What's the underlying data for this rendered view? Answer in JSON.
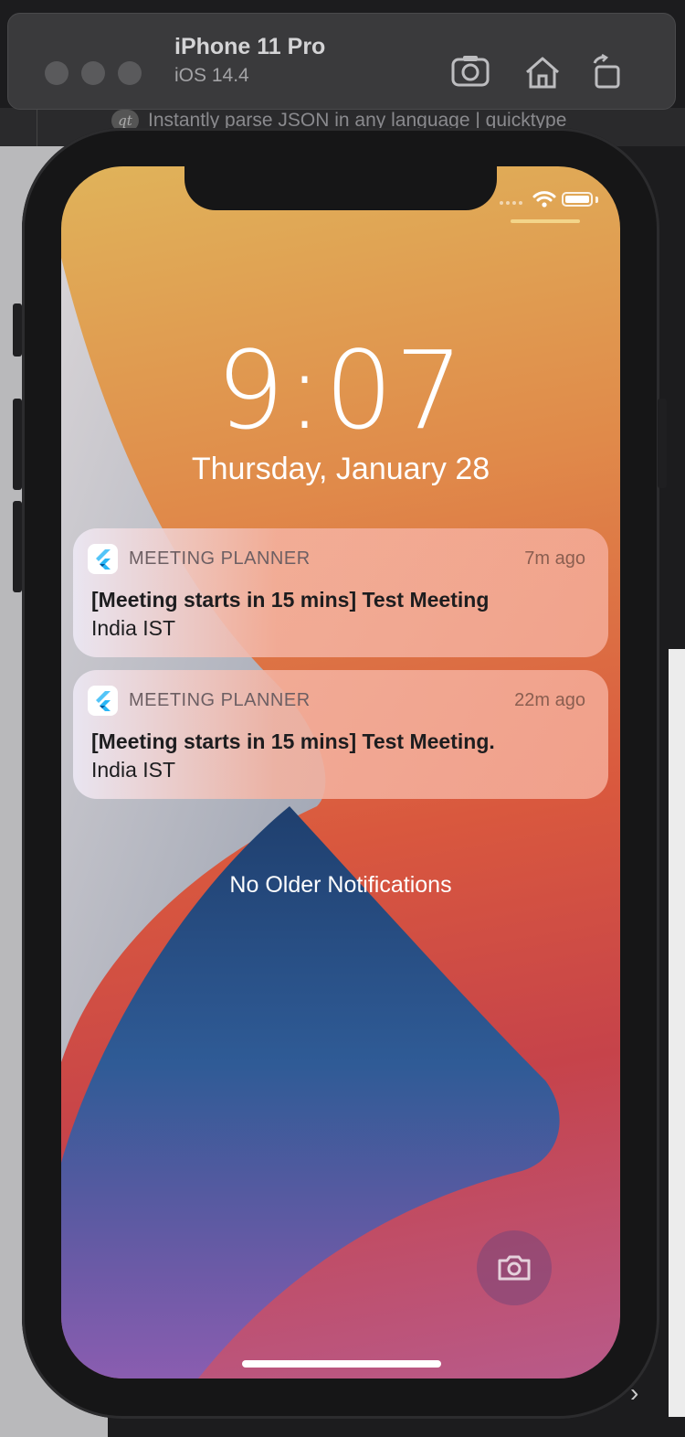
{
  "simulator": {
    "device_name": "iPhone 11 Pro",
    "os_version": "iOS 14.4",
    "toolbar_icons": [
      "screenshot-icon",
      "home-icon",
      "rotate-icon"
    ]
  },
  "browser_tab": {
    "badge": "qt",
    "title": "Instantly parse JSON in any language | quicktype"
  },
  "lock_screen": {
    "time": "9:07",
    "date": "Thursday, January 28",
    "no_older": "No Older Notifications"
  },
  "notifications": [
    {
      "app": "MEETING PLANNER",
      "time": "7m ago",
      "title": "[Meeting starts in 15 mins] Test Meeting",
      "body": "India IST"
    },
    {
      "app": "MEETING PLANNER",
      "time": "22m ago",
      "title": "[Meeting starts in 15 mins] Test Meeting.",
      "body": "India IST"
    }
  ],
  "colors": {
    "flutter_light": "#54c5f8",
    "flutter_dark": "#01579b"
  }
}
